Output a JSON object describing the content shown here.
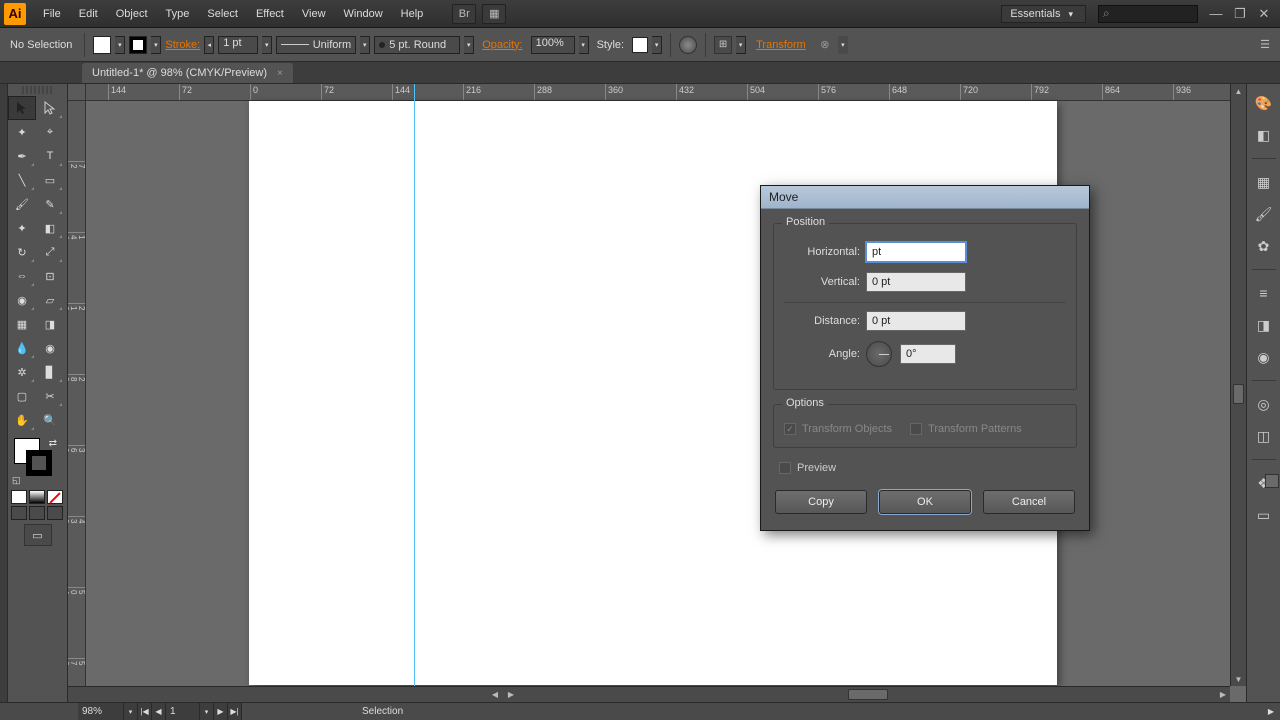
{
  "menu": [
    "File",
    "Edit",
    "Object",
    "Type",
    "Select",
    "Effect",
    "View",
    "Window",
    "Help"
  ],
  "workspace": "Essentials",
  "selectionLabel": "No Selection",
  "strokeLabel": "Stroke:",
  "strokeWidth": "1 pt",
  "strokeProfile": "Uniform",
  "brush": "5 pt. Round",
  "opacityLabel": "Opacity:",
  "opacityValue": "100%",
  "styleLabel": "Style:",
  "transform": "Transform",
  "docTab": "Untitled-1* @ 98% (CMYK/Preview)",
  "ruler": [
    "144",
    "72",
    "0",
    "72",
    "144",
    "216",
    "288",
    "360",
    "432",
    "504",
    "576",
    "648",
    "720",
    "792",
    "864",
    "936"
  ],
  "rulerV": [
    "72",
    "144",
    "216",
    "288",
    "360",
    "432",
    "504",
    "576"
  ],
  "rulerVsub": [
    "",
    "",
    "",
    "",
    "",
    "",
    "",
    ""
  ],
  "status": {
    "zoom": "98%",
    "page": "1",
    "tool": "Selection"
  },
  "dialog": {
    "title": "Move",
    "position": "Position",
    "horizontal": "Horizontal:",
    "hval": "pt",
    "vertical": "Vertical:",
    "vval": "0 pt",
    "distance": "Distance:",
    "dval": "0 pt",
    "angle": "Angle:",
    "aval": "0°",
    "options": "Options",
    "tobj": "Transform Objects",
    "tpat": "Transform Patterns",
    "preview": "Preview",
    "copy": "Copy",
    "ok": "OK",
    "cancel": "Cancel"
  }
}
